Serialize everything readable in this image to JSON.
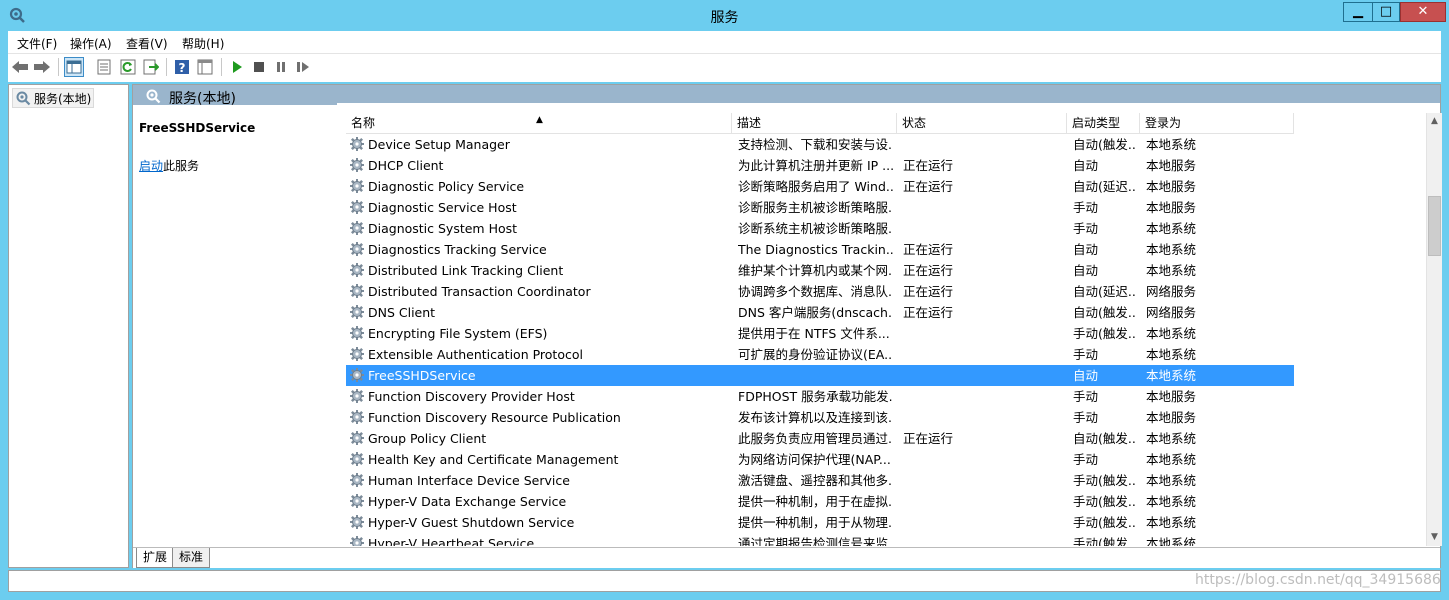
{
  "window": {
    "title": "服务"
  },
  "menu": [
    "文件(F)",
    "操作(A)",
    "查看(V)",
    "帮助(H)"
  ],
  "toolbar": [
    "back-icon",
    "forward-icon",
    "console-tree-icon",
    "properties-icon",
    "refresh-icon",
    "export-icon",
    "help-icon",
    "view-icon",
    "start-icon",
    "stop-icon",
    "pause-icon",
    "resume-icon"
  ],
  "tree": {
    "root": "服务(本地)"
  },
  "pane": {
    "header": "服务(本地)",
    "detail_title": "FreeSSHDService",
    "link_text": "启动",
    "link_suffix": "此服务"
  },
  "columns": [
    "名称",
    "描述",
    "状态",
    "启动类型",
    "登录为"
  ],
  "rows": [
    {
      "name": "Device Setup Manager",
      "desc": "支持检测、下载和安装与设...",
      "status": "",
      "startup": "自动(触发...",
      "logon": "本地系统"
    },
    {
      "name": "DHCP Client",
      "desc": "为此计算机注册并更新 IP ...",
      "status": "正在运行",
      "startup": "自动",
      "logon": "本地服务"
    },
    {
      "name": "Diagnostic Policy Service",
      "desc": "诊断策略服务启用了 Wind...",
      "status": "正在运行",
      "startup": "自动(延迟...",
      "logon": "本地服务"
    },
    {
      "name": "Diagnostic Service Host",
      "desc": "诊断服务主机被诊断策略服...",
      "status": "",
      "startup": "手动",
      "logon": "本地服务"
    },
    {
      "name": "Diagnostic System Host",
      "desc": "诊断系统主机被诊断策略服...",
      "status": "",
      "startup": "手动",
      "logon": "本地系统"
    },
    {
      "name": "Diagnostics Tracking Service",
      "desc": "The Diagnostics Trackin...",
      "status": "正在运行",
      "startup": "自动",
      "logon": "本地系统"
    },
    {
      "name": "Distributed Link Tracking Client",
      "desc": "维护某个计算机内或某个网...",
      "status": "正在运行",
      "startup": "自动",
      "logon": "本地系统"
    },
    {
      "name": "Distributed Transaction Coordinator",
      "desc": "协调跨多个数据库、消息队...",
      "status": "正在运行",
      "startup": "自动(延迟...",
      "logon": "网络服务"
    },
    {
      "name": "DNS Client",
      "desc": "DNS 客户端服务(dnscach...",
      "status": "正在运行",
      "startup": "自动(触发...",
      "logon": "网络服务"
    },
    {
      "name": "Encrypting File System (EFS)",
      "desc": "提供用于在 NTFS 文件系...",
      "status": "",
      "startup": "手动(触发...",
      "logon": "本地系统"
    },
    {
      "name": "Extensible Authentication Protocol",
      "desc": "可扩展的身份验证协议(EA...",
      "status": "",
      "startup": "手动",
      "logon": "本地系统"
    },
    {
      "name": "FreeSSHDService",
      "desc": "",
      "status": "",
      "startup": "自动",
      "logon": "本地系统",
      "selected": true
    },
    {
      "name": "Function Discovery Provider Host",
      "desc": "FDPHOST 服务承载功能发...",
      "status": "",
      "startup": "手动",
      "logon": "本地服务"
    },
    {
      "name": "Function Discovery Resource Publication",
      "desc": "发布该计算机以及连接到该...",
      "status": "",
      "startup": "手动",
      "logon": "本地服务"
    },
    {
      "name": "Group Policy Client",
      "desc": "此服务负责应用管理员通过...",
      "status": "正在运行",
      "startup": "自动(触发...",
      "logon": "本地系统"
    },
    {
      "name": "Health Key and Certificate Management",
      "desc": "为网络访问保护代理(NAP...",
      "status": "",
      "startup": "手动",
      "logon": "本地系统"
    },
    {
      "name": "Human Interface Device Service",
      "desc": "激活键盘、遥控器和其他多...",
      "status": "",
      "startup": "手动(触发...",
      "logon": "本地系统"
    },
    {
      "name": "Hyper-V Data Exchange Service",
      "desc": "提供一种机制，用于在虚拟...",
      "status": "",
      "startup": "手动(触发...",
      "logon": "本地系统"
    },
    {
      "name": "Hyper-V Guest Shutdown Service",
      "desc": "提供一种机制，用于从物理...",
      "status": "",
      "startup": "手动(触发...",
      "logon": "本地系统"
    },
    {
      "name": "Hyper-V Heartbeat Service",
      "desc": "通过定期报告检测信号来监...",
      "status": "",
      "startup": "手动(触发...",
      "logon": "本地系统"
    }
  ],
  "tabs": [
    "扩展",
    "标准"
  ],
  "watermark": "https://blog.csdn.net/qq_34915686"
}
